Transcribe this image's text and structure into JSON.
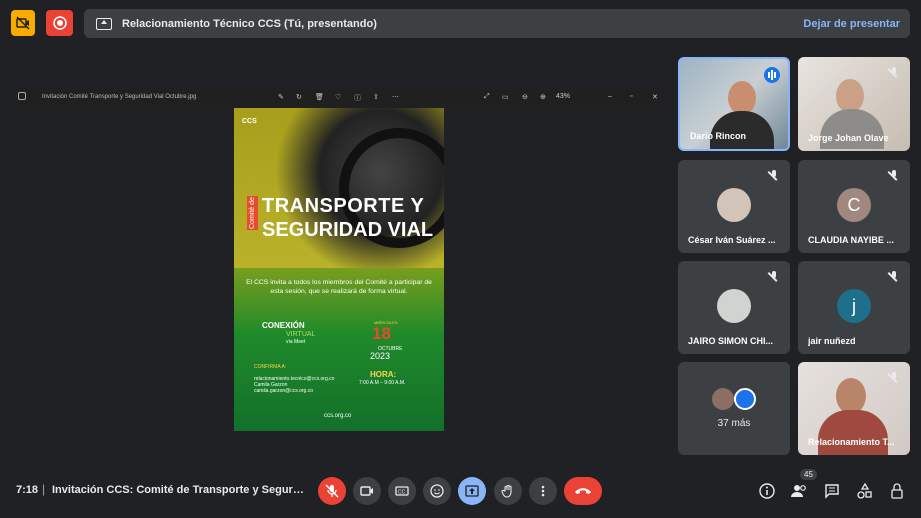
{
  "presenting_bar": {
    "title": "Relacionamiento Técnico CCS (Tú, presentando)",
    "stop_label": "Dejar de presentar"
  },
  "viewer": {
    "file_name": "Invitación Comité Transporte y Seguridad Vial Octubre.jpg",
    "zoom": "43%"
  },
  "poster": {
    "brand": "CCS",
    "brand_sub": "Comité de",
    "title_line1": "TRANSPORTE Y",
    "title_line2": "SEGURIDAD VIAL",
    "body": "El CCS invita a todos los miembros del Comité a participar de esta sesión, que se realizará de forma virtual.",
    "conexion": "CONEXIÓN",
    "virtual": "VIRTUAL",
    "via": "vía Meet",
    "confirm": "CONFIRMA A:",
    "confirm_email": "relacionamiento.tecnico@ccs.org.co",
    "contact_name": "Camila Garzon",
    "contact_email": "camila.garzon@ccs.org.co",
    "day_label": "MIÉRCOLES",
    "day": "18",
    "month": "OCTUBRE",
    "year": "2023",
    "hora_label": "HORA:",
    "hora": "7:00 A.M – 9:00 A.M.",
    "site": "ccs.org.co"
  },
  "participants": [
    {
      "name": "Dario Rincon",
      "speaking": true
    },
    {
      "name": "Jorge Johan Olave",
      "muted": true
    },
    {
      "name": "César Iván Suárez ...",
      "muted": true
    },
    {
      "name": "CLAUDIA NAYIBE ...",
      "muted": true,
      "initial": "C",
      "color": "#a1887f"
    },
    {
      "name": "JAIRO SIMON CHI...",
      "muted": true
    },
    {
      "name": "jair nuñezd",
      "muted": true,
      "initial": "j",
      "color": "#1e6f8c"
    },
    {
      "name": "37 más"
    },
    {
      "name": "Relacionamiento T...",
      "muted": true
    }
  ],
  "bottom": {
    "time": "7:18",
    "meeting_title": "Invitación CCS: Comité de Transporte y Seguridad Vial",
    "people_count": "45"
  }
}
